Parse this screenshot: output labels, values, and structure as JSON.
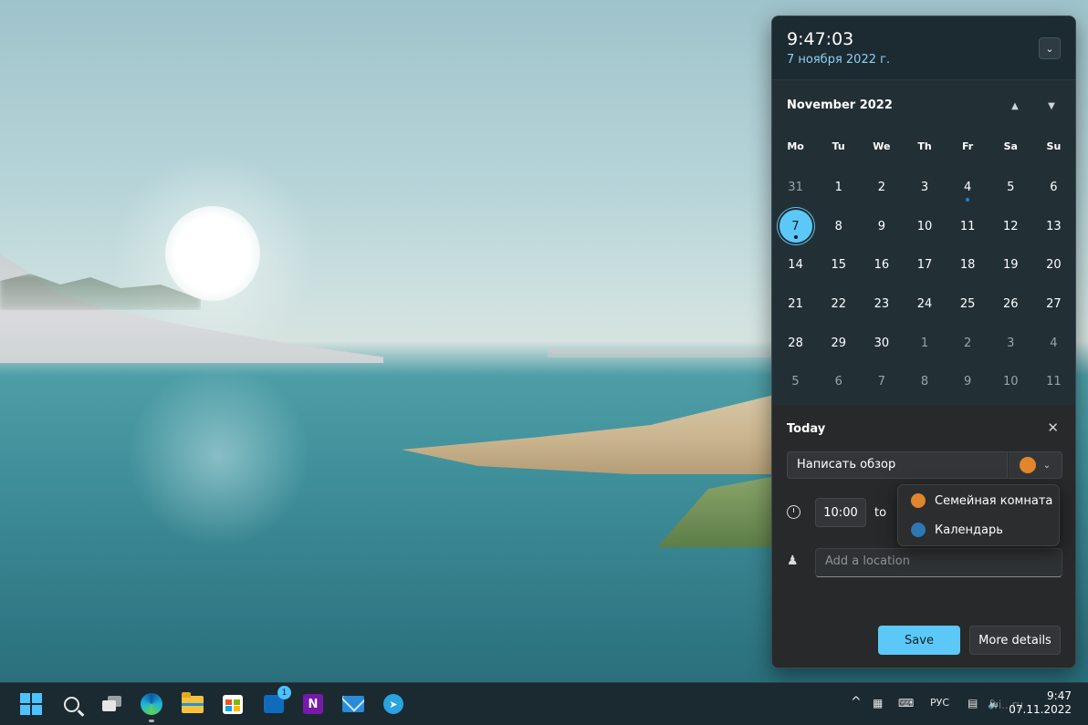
{
  "clock": {
    "time": "9:47:03",
    "date": "7 ноября 2022 г.",
    "collapse_icon": "chevron-down-icon"
  },
  "calendar": {
    "month_label": "November 2022",
    "nav_prev_icon": "triangle-up-icon",
    "nav_next_icon": "triangle-down-icon",
    "weekdays": [
      "Mo",
      "Tu",
      "We",
      "Th",
      "Fr",
      "Sa",
      "Su"
    ],
    "weeks": [
      [
        "31",
        "1",
        "2",
        "3",
        "4",
        "5",
        "6"
      ],
      [
        "7",
        "8",
        "9",
        "10",
        "11",
        "12",
        "13"
      ],
      [
        "14",
        "15",
        "16",
        "17",
        "18",
        "19",
        "20"
      ],
      [
        "21",
        "22",
        "23",
        "24",
        "25",
        "26",
        "27"
      ],
      [
        "28",
        "29",
        "30",
        "1",
        "2",
        "3",
        "4"
      ],
      [
        "5",
        "6",
        "7",
        "8",
        "9",
        "10",
        "11"
      ]
    ],
    "today": "7",
    "accent_color": "#5cc8f8",
    "event_dot_color": "#1c87d4"
  },
  "event": {
    "heading": "Today",
    "close_icon": "close-icon",
    "name_value": "Написать обзор",
    "selected_calendar_color": "#e0862d",
    "start_time": "10:00",
    "to_label": "to",
    "location_placeholder": "Add a location",
    "save_label": "Save",
    "more_details_label": "More details"
  },
  "calendar_dropdown": {
    "options": [
      {
        "label": "Семейная комната",
        "color": "#e0862d"
      },
      {
        "label": "Календарь",
        "color": "#2d77b5"
      }
    ]
  },
  "taskbar": {
    "apps": [
      "start-icon",
      "search-icon",
      "task-view-icon",
      "edge-icon",
      "file-explorer-icon",
      "store-icon",
      "outlook-icon",
      "onenote-icon",
      "mail-icon",
      "telegram-icon"
    ],
    "outlook_badge": "1",
    "onenote_letter": "N",
    "tray": {
      "chevron": "^",
      "language": "РУС",
      "time": "9:47",
      "date": "07.11.2022"
    },
    "watermark": "wi...ru"
  }
}
